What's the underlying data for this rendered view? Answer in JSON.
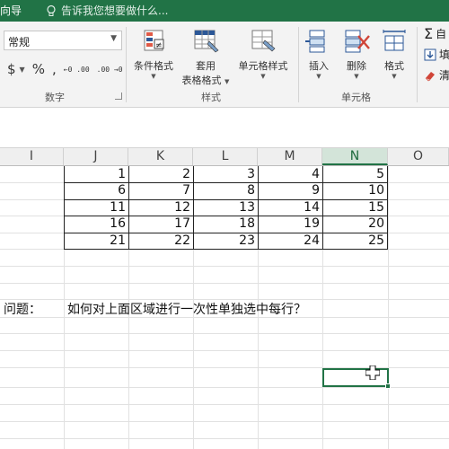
{
  "ribbon_tab": "向导",
  "tell_me": {
    "placeholder": "告诉我您想要做什么..."
  },
  "number_group": {
    "format_value": "常规",
    "currency": "$",
    "percent": "%",
    "comma": ",",
    "increase_decimal": "←0 .00",
    "decrease_decimal": ".00 →0",
    "label": "数字"
  },
  "styles_group": {
    "conditional_format": "条件格式",
    "table_format_line1": "套用",
    "table_format_line2": "表格格式",
    "cell_styles": "单元格样式",
    "label": "样式"
  },
  "cells_group": {
    "insert": "插入",
    "delete": "删除",
    "format": "格式",
    "label": "单元格"
  },
  "editing_group": {
    "autosum": "自",
    "fill": "填",
    "clear": "清"
  },
  "columns": [
    "I",
    "J",
    "K",
    "L",
    "M",
    "N",
    "O"
  ],
  "selected_column": "N",
  "table": [
    [
      1,
      2,
      3,
      4,
      5
    ],
    [
      6,
      7,
      8,
      9,
      10
    ],
    [
      11,
      12,
      13,
      14,
      15
    ],
    [
      16,
      17,
      18,
      19,
      20
    ],
    [
      21,
      22,
      23,
      24,
      25
    ]
  ],
  "question": {
    "label": "问题：",
    "text": "如何对上面区域进行一次性单独选中每行？"
  },
  "colors": {
    "accent": "#217346",
    "selected_header_bg": "#d3e4d9"
  }
}
